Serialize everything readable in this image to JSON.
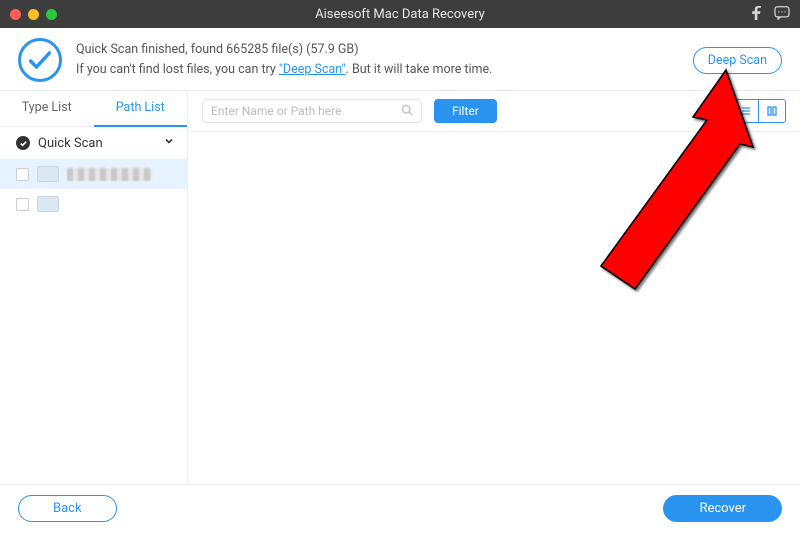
{
  "titlebar": {
    "app_title": "Aiseesoft Mac Data Recovery"
  },
  "header": {
    "status_line": "Quick Scan finished, found 665285 file(s) (57.9 GB)",
    "hint_pre": "If you can't find lost files, you can try ",
    "hint_link": "\"Deep Scan\"",
    "hint_post": ". But it will take more time.",
    "deep_scan_button": "Deep Scan"
  },
  "tabs": {
    "type_list": "Type List",
    "path_list": "Path List",
    "active": "path_list"
  },
  "sidebar": {
    "group_title": "Quick Scan"
  },
  "toolbar": {
    "search_placeholder": "Enter Name or Path here",
    "filter_label": "Filter"
  },
  "footer": {
    "back": "Back",
    "recover": "Recover"
  },
  "colors": {
    "primary": "#2a93ef"
  }
}
